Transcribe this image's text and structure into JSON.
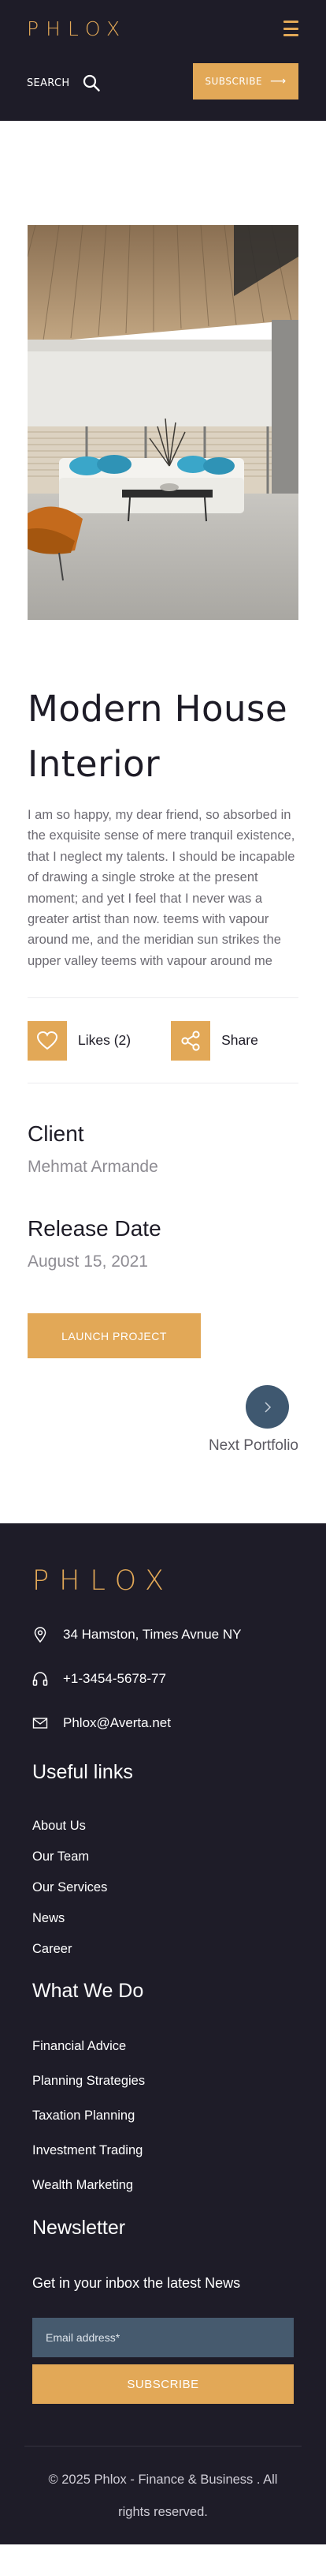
{
  "header": {
    "logo": "PHLOX",
    "search_label": "SEARCH",
    "subscribe_label": "SUBSCRIBE",
    "subscribe_arrow": "⟶"
  },
  "project": {
    "title": "Modern House Interior",
    "description": "I am so happy, my dear friend, so absorbed in the exquisite sense of mere tranquil existence, that I neglect my talents. I should be incapable of drawing a single stroke at the present moment; and yet I feel that I never was a greater artist than now. teems with vapour around me, and the meridian sun strikes the upper valley teems with vapour around me",
    "likes_label": "Likes (2)",
    "share_label": "Share",
    "client_label": "Client",
    "client_value": "Mehmat Armande",
    "release_label": "Release Date",
    "release_value": "August 15, 2021",
    "launch_label": "LAUNCH PROJECT",
    "next_label": "Next Portfolio"
  },
  "footer": {
    "logo": "PHLOX",
    "address": "34 Hamston, Times Avnue NY",
    "phone": "+1-3454-5678-77",
    "email": "Phlox@Averta.net",
    "useful_links_heading": "Useful links",
    "useful_links": [
      "About Us",
      "Our Team",
      "Our Services",
      "News",
      "Career"
    ],
    "what_we_do_heading": "What We Do",
    "what_we_do": [
      "Financial Advice",
      "Planning Strategies",
      "Taxation Planning",
      "Investment Trading",
      "Wealth Marketing"
    ],
    "newsletter_heading": "Newsletter",
    "newsletter_text": "Get in your inbox the latest News",
    "email_placeholder": "Email address*",
    "subscribe_label": "SUBSCRIBE",
    "copyright": "© 2025 Phlox - Finance & Business . All rights reserved."
  },
  "colors": {
    "accent": "#e2a857",
    "dark": "#1e1c28",
    "next_button": "#3f5870"
  },
  "icons": [
    "hamburger-menu-icon",
    "search-icon",
    "heart-icon",
    "share-icon",
    "chevron-right-icon",
    "location-pin-icon",
    "headphones-icon",
    "envelope-icon"
  ]
}
